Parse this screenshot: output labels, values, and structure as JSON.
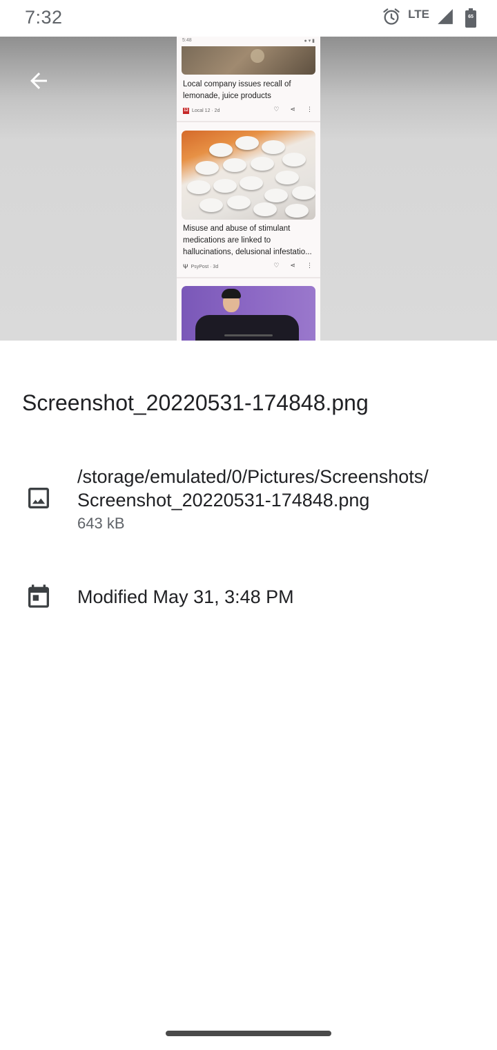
{
  "status_bar": {
    "time": "7:32",
    "network": "LTE",
    "battery_level": "65",
    "icons": [
      "alarm-icon",
      "signal-icon",
      "battery-icon"
    ]
  },
  "preview": {
    "back_icon": "arrow-back-icon",
    "mini_status_time": "5:48",
    "cards": [
      {
        "title": "Local company issues recall of lemonade, juice products",
        "source_badge": "12",
        "source": "Local 12 · 2d"
      },
      {
        "title": "Misuse and abuse of stimulant medications are linked to hallucinations, delusional infestatio...",
        "source": "PsyPost · 3d"
      }
    ]
  },
  "details": {
    "file_name": "Screenshot_20220531-174848.png",
    "path_line1": "/storage/emulated/0/Pictures/Screenshots/",
    "path_line2": "Screenshot_20220531-174848.png",
    "size": "643 kB",
    "modified": "Modified May 31, 3:48 PM",
    "path_icon": "image-icon",
    "date_icon": "calendar-icon"
  },
  "colors": {
    "text_primary": "#202124",
    "text_secondary": "#5f6368",
    "icon": "#3c4043"
  }
}
